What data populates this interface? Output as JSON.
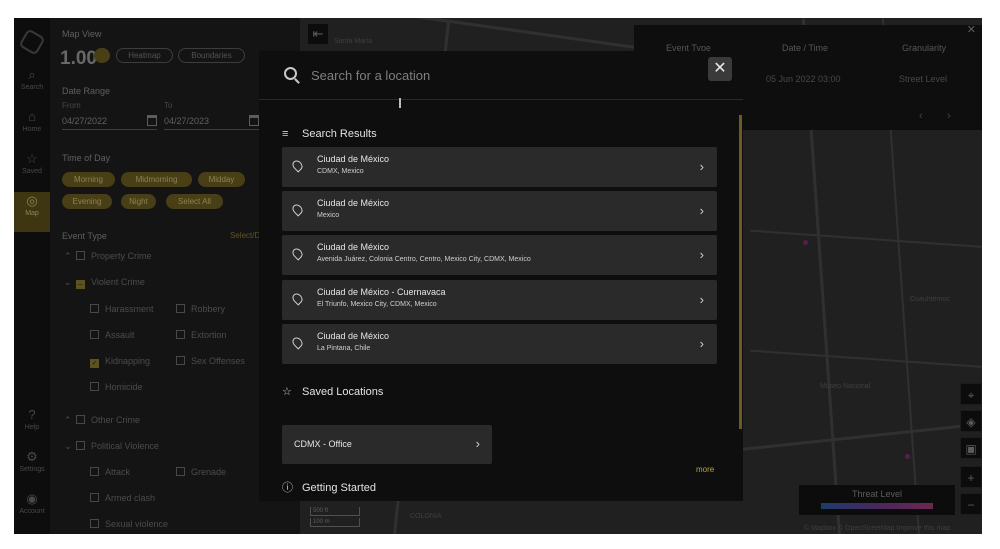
{
  "rail": {
    "items": [
      {
        "label": "Search",
        "icon": "search-icon"
      },
      {
        "label": "Home",
        "icon": "home-icon"
      },
      {
        "label": "Saved",
        "icon": "star-icon"
      },
      {
        "label": "Map",
        "icon": "map-pin-icon"
      },
      {
        "label": "Help",
        "icon": "help-icon"
      },
      {
        "label": "Settings",
        "icon": "gear-icon"
      },
      {
        "label": "Account",
        "icon": "account-icon"
      }
    ]
  },
  "panel": {
    "map_view_label": "Map View",
    "zoom_value": "1.00",
    "view_options": [
      "Heatmap",
      "Boundaries"
    ],
    "date_range_label": "Date Range",
    "from_label": "From",
    "to_label": "To",
    "from_value": "04/27/2022",
    "to_value": "04/27/2023",
    "time_of_day_label": "Time of Day",
    "time_options": [
      "Morning",
      "Midmorning",
      "Midday",
      "Evening",
      "Night",
      "Select All"
    ],
    "event_type_label": "Event Type",
    "select_link": "Select/Des",
    "events": {
      "property_crime": "Property Crime",
      "violent_crime": "Violent Crime",
      "harassment": "Harassment",
      "robbery": "Robbery",
      "assault": "Assault",
      "extortion": "Extortion",
      "kidnapping": "Kidnapping",
      "sex_offenses": "Sex Offenses",
      "homicide": "Homicide",
      "other_crime": "Other Crime",
      "political_violence": "Political Violence",
      "attack": "Attack",
      "grenade": "Grenade",
      "armed_clash": "Armed clash",
      "sexual_violence": "Sexual violence"
    }
  },
  "map": {
    "labels": [
      "COLONIA",
      "Museo Nacional",
      "Cuauhtémoc",
      "Santa María"
    ],
    "event_table": {
      "headers": [
        "Event Type",
        "Date / Time",
        "Granularity"
      ],
      "row": [
        "",
        "05 Jun 2022 03:00",
        "Street Level"
      ]
    },
    "threat_level_label": "Threat Level",
    "attribution": "© Mapbox © OpenStreetMap  Improve this map",
    "scale": [
      "500 ft",
      "100 m"
    ]
  },
  "modal": {
    "search_placeholder": "Search for a location",
    "search_value": "",
    "close_label": "✕",
    "search_results_title": "Search Results",
    "results": [
      {
        "title": "Ciudad de México",
        "address": "CDMX, Mexico"
      },
      {
        "title": "Ciudad de México",
        "address": "Mexico"
      },
      {
        "title": "Ciudad de México",
        "address": "Avenida Juárez, Colonia Centro, Centro, Mexico City, CDMX, Mexico"
      },
      {
        "title": "Ciudad de México - Cuernavaca",
        "address": "El Triunfo, Mexico City, CDMX, Mexico"
      },
      {
        "title": "Ciudad de México",
        "address": "La Pintana, Chile"
      }
    ],
    "saved_title": "Saved Locations",
    "saved_items": [
      {
        "title": "CDMX - Office"
      }
    ],
    "more_label": "more",
    "getting_started_title": "Getting Started"
  },
  "colors": {
    "accent": "#8a7a30",
    "modal_bg": "#0e0e0e",
    "card_bg": "#2a2a2a"
  }
}
